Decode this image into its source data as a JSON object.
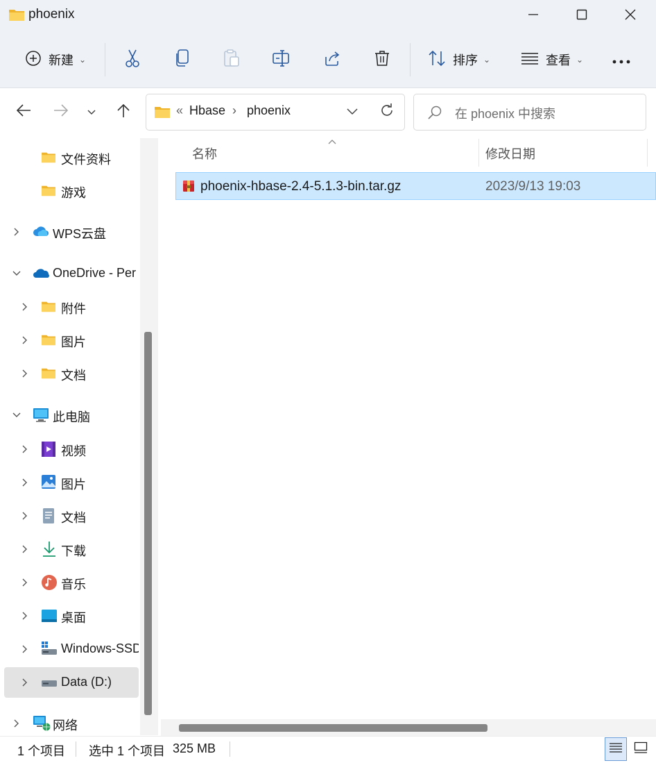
{
  "window": {
    "title": "phoenix",
    "minimize": "minimize",
    "maximize": "maximize",
    "close": "close"
  },
  "toolbar": {
    "new_label": "新建",
    "sort_label": "排序",
    "view_label": "查看",
    "icons": [
      "plus-circle-icon",
      "scissors-icon",
      "copy-icon",
      "paste-icon",
      "rename-icon",
      "share-icon",
      "trash-icon",
      "sort-icon",
      "view-lines-icon",
      "more-icon"
    ]
  },
  "address": {
    "overflow": "«",
    "crumbs": [
      "Hbase",
      "phoenix"
    ],
    "separator": "›"
  },
  "search": {
    "placeholder": "在 phoenix 中搜索"
  },
  "sidebar": {
    "items": [
      {
        "label": "文件资料",
        "icon": "folder-icon"
      },
      {
        "label": "游戏",
        "icon": "folder-icon"
      },
      {
        "label": "WPS云盘",
        "icon": "cloud-icon"
      },
      {
        "label": "OneDrive - Per",
        "icon": "onedrive-icon"
      },
      {
        "label": "附件",
        "icon": "folder-icon"
      },
      {
        "label": "图片",
        "icon": "folder-icon"
      },
      {
        "label": "文档",
        "icon": "folder-icon"
      },
      {
        "label": "此电脑",
        "icon": "computer-icon"
      },
      {
        "label": "视频",
        "icon": "video-icon"
      },
      {
        "label": "图片",
        "icon": "pictures-icon"
      },
      {
        "label": "文档",
        "icon": "documents-icon"
      },
      {
        "label": "下载",
        "icon": "download-icon"
      },
      {
        "label": "音乐",
        "icon": "music-icon"
      },
      {
        "label": "桌面",
        "icon": "desktop-icon"
      },
      {
        "label": "Windows-SSD",
        "icon": "drive-icon"
      },
      {
        "label": "Data (D:)",
        "icon": "drive-icon"
      },
      {
        "label": "网络",
        "icon": "network-icon"
      }
    ]
  },
  "columns": {
    "name": "名称",
    "date": "修改日期"
  },
  "files": [
    {
      "name": "phoenix-hbase-2.4-5.1.3-bin.tar.gz",
      "modified": "2023/9/13 19:03",
      "icon": "archive-icon"
    }
  ],
  "status": {
    "count": "1 个项目",
    "selected": "选中 1 个项目",
    "size": "325 MB"
  },
  "colors": {
    "chrome_bg": "#eef2f6",
    "selection_bg": "#cce8ff",
    "selection_border": "#99d1ff",
    "folder_yellow": "#f8c94d",
    "accent_blue": "#0067c0"
  }
}
